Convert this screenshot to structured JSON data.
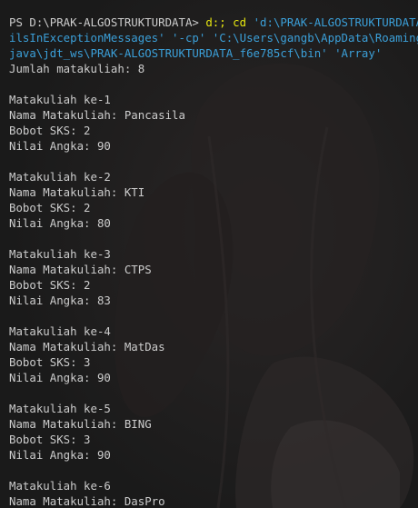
{
  "terminal": {
    "prompt": "PS D:\\PRAK-ALGOSTRUKTURDATA> ",
    "cmd_drive": "d:; cd ",
    "cmd_path": "'d:\\PRAK-ALGOSTRUKTURDATA';",
    "wrap_line_1": "ilsInExceptionMessages' '-cp' 'C:\\Users\\gangb\\AppData\\Roaming\\Cod",
    "wrap_line_2": "java\\jdt_ws\\PRAK-ALGOSTRUKTURDATA_f6e785cf\\bin' 'Array'",
    "count_line": "Jumlah matakuliah: 8"
  },
  "entries": [
    {
      "header": "Matakuliah ke-1",
      "name": "Nama Matakuliah: Pancasila",
      "sks": "Bobot SKS: 2",
      "nilai": "Nilai Angka: 90"
    },
    {
      "header": "Matakuliah ke-2",
      "name": "Nama Matakuliah: KTI",
      "sks": "Bobot SKS: 2",
      "nilai": "Nilai Angka: 80"
    },
    {
      "header": "Matakuliah ke-3",
      "name": "Nama Matakuliah: CTPS",
      "sks": "Bobot SKS: 2",
      "nilai": "Nilai Angka: 83"
    },
    {
      "header": "Matakuliah ke-4",
      "name": "Nama Matakuliah: MatDas",
      "sks": "Bobot SKS: 3",
      "nilai": "Nilai Angka: 90"
    },
    {
      "header": "Matakuliah ke-5",
      "name": "Nama Matakuliah: BING",
      "sks": "Bobot SKS: 3",
      "nilai": "Nilai Angka: 90"
    },
    {
      "header": "Matakuliah ke-6",
      "name": "Nama Matakuliah: DasPro"
    }
  ],
  "colors": {
    "background": "#1e1e1e",
    "text": "#cccccc",
    "command": "#e5e510",
    "string": "#3b9fd8"
  }
}
